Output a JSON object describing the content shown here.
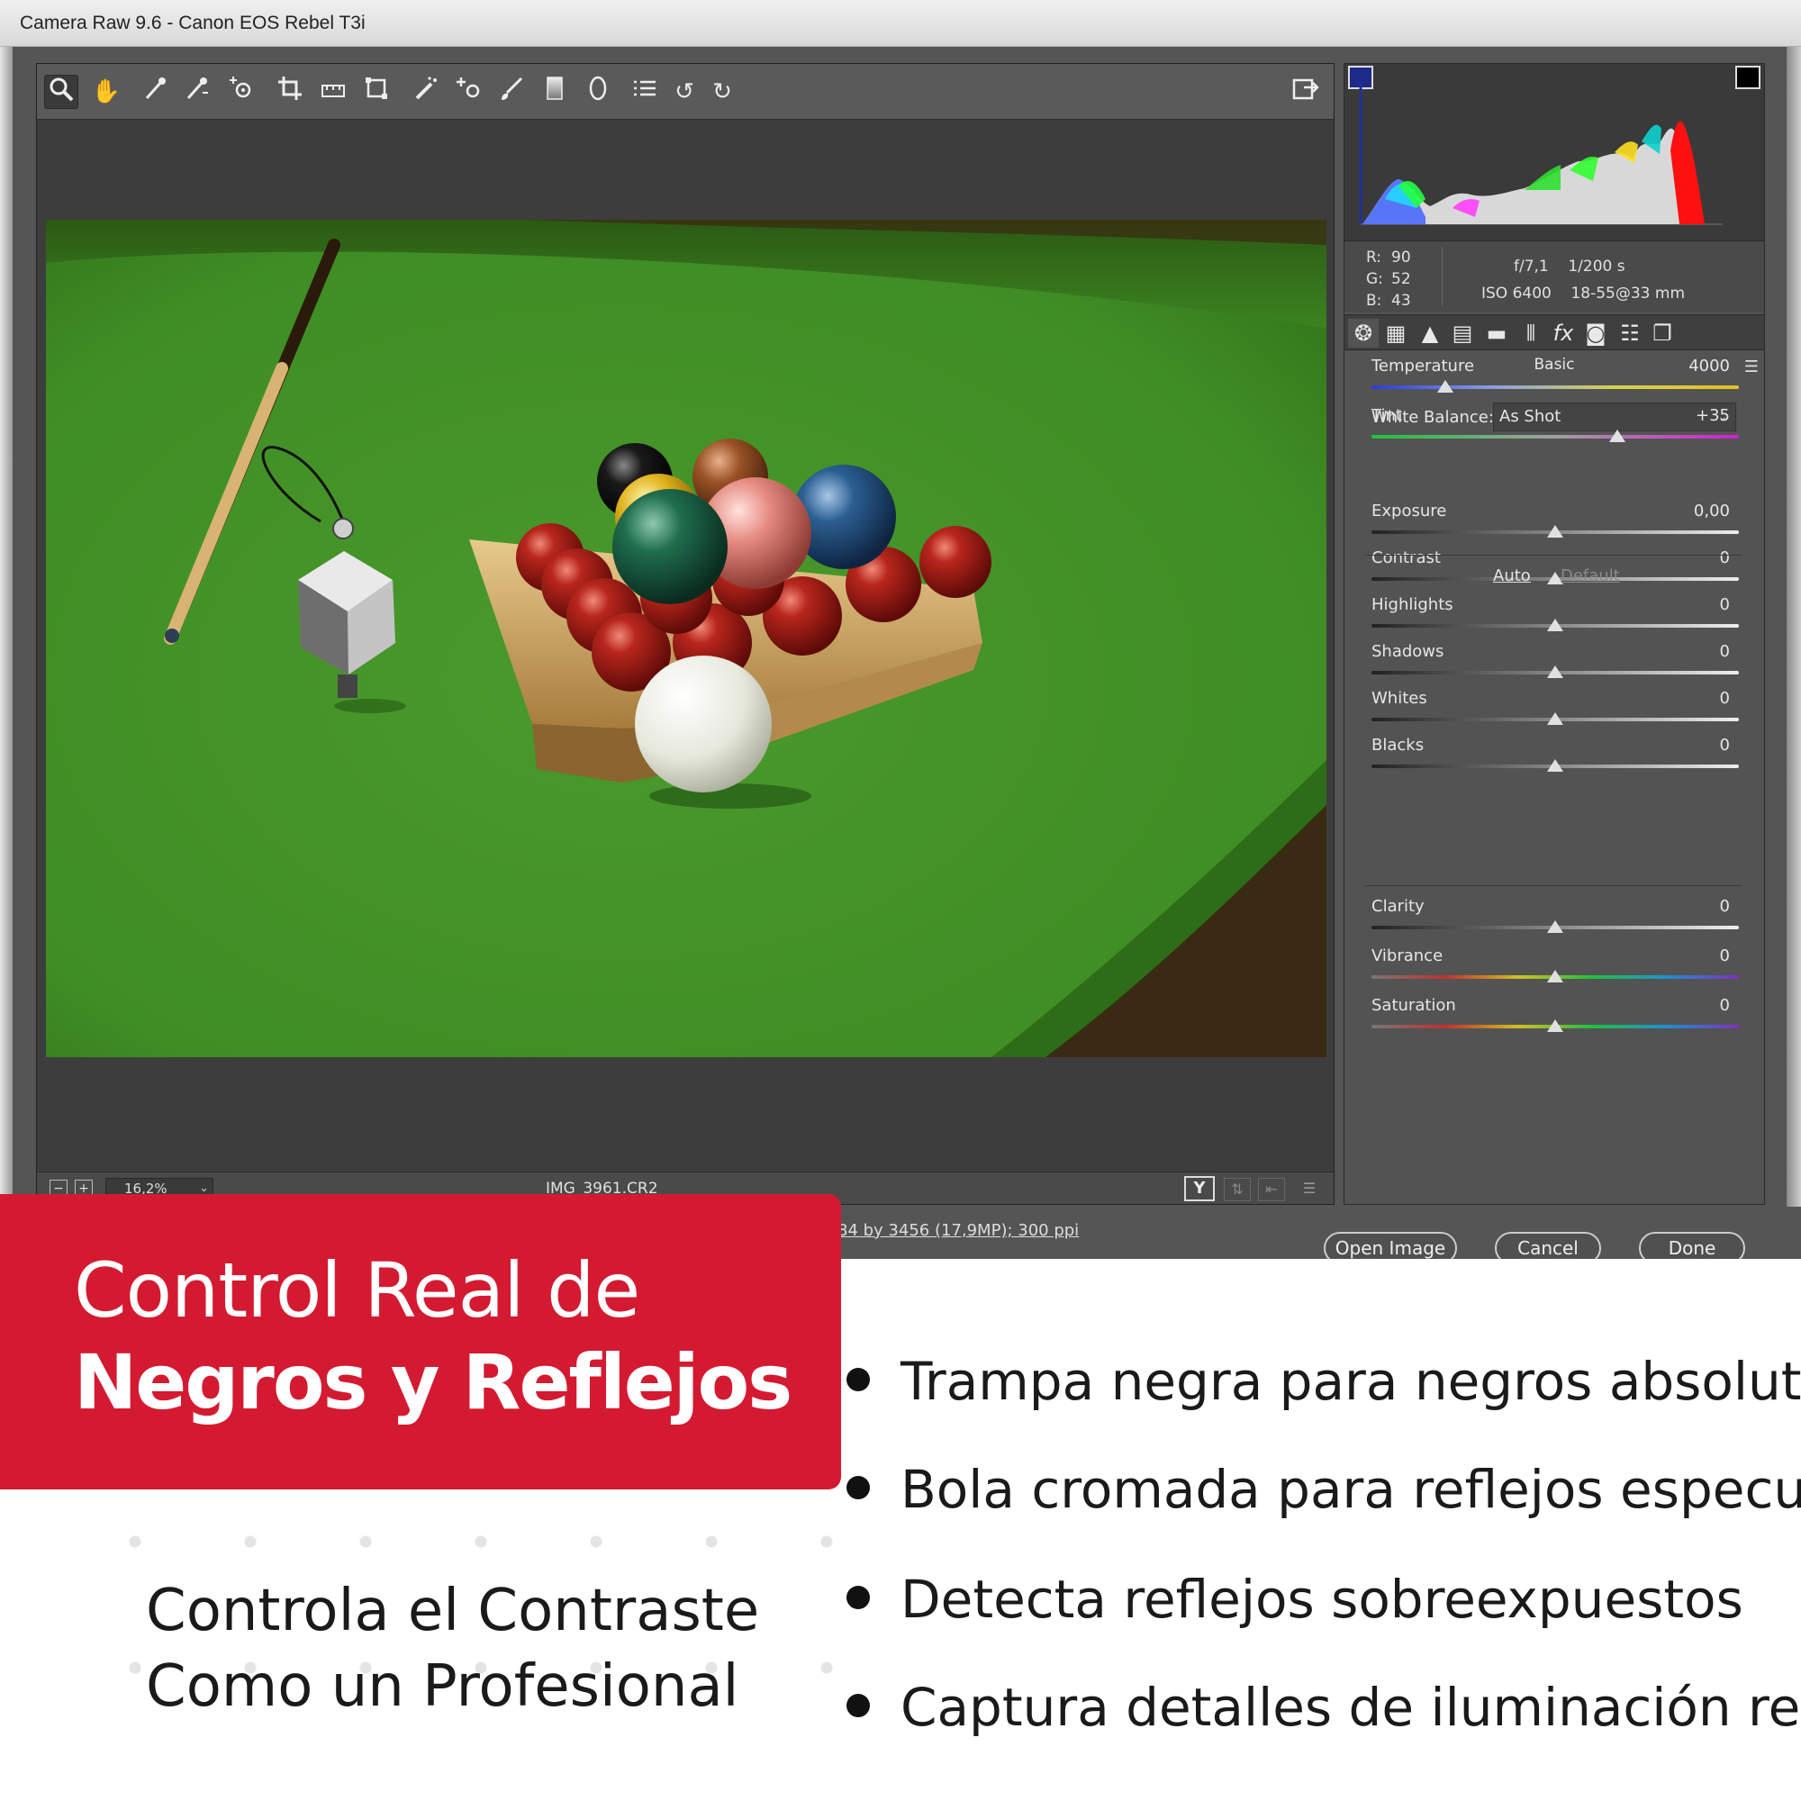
{
  "window": {
    "title": "Camera Raw 9.6  -  Canon EOS Rebel T3i"
  },
  "toolbar": {
    "tools": [
      {
        "icon": "zoom-icon",
        "glyph": "🔍"
      },
      {
        "icon": "hand-icon",
        "glyph": "✋"
      },
      {
        "icon": "white-balance-icon",
        "glyph": "⁄"
      },
      {
        "icon": "color-sampler-icon",
        "glyph": "⁄"
      },
      {
        "icon": "targeted-adjustment-icon",
        "glyph": "⊙"
      },
      {
        "icon": "crop-icon",
        "glyph": "⌗"
      },
      {
        "icon": "straighten-icon",
        "glyph": "▭"
      },
      {
        "icon": "transform-icon",
        "glyph": "⌑"
      },
      {
        "icon": "spot-removal-icon",
        "glyph": "✎"
      },
      {
        "icon": "red-eye-icon",
        "glyph": "+o"
      },
      {
        "icon": "adjustment-brush-icon",
        "glyph": "∕"
      },
      {
        "icon": "graduated-filter-icon",
        "glyph": "▮"
      },
      {
        "icon": "radial-filter-icon",
        "glyph": "○"
      },
      {
        "icon": "preferences-icon",
        "glyph": "☰"
      },
      {
        "icon": "rotate-left-icon",
        "glyph": "↺"
      },
      {
        "icon": "rotate-right-icon",
        "glyph": "↻"
      }
    ],
    "fullscreen_icon": "fullscreen-icon"
  },
  "preview": {
    "zoom": "16,2%",
    "filename": "IMG_3961.CR2",
    "y_button": "Y"
  },
  "readout": {
    "r": "90",
    "g": "52",
    "b": "43",
    "r_label": "R:",
    "g_label": "G:",
    "b_label": "B:",
    "aperture_shutter": "f/7,1    1/200 s",
    "iso_lens": "ISO 6400    18-55@33 mm"
  },
  "panel": {
    "section_title": "Basic",
    "white_balance_label": "White Balance:",
    "white_balance_value": "As Shot",
    "auto_label": "Auto",
    "default_label": "Default",
    "sliders": [
      {
        "label": "Temperature",
        "value": "4000",
        "position": 0.2
      },
      {
        "label": "Tint",
        "value": "+35",
        "position": 0.67
      },
      {
        "label": "Exposure",
        "value": "0,00",
        "position": 0.5
      },
      {
        "label": "Contrast",
        "value": "0",
        "position": 0.5
      },
      {
        "label": "Highlights",
        "value": "0",
        "position": 0.5
      },
      {
        "label": "Shadows",
        "value": "0",
        "position": 0.5
      },
      {
        "label": "Whites",
        "value": "0",
        "position": 0.5
      },
      {
        "label": "Blacks",
        "value": "0",
        "position": 0.5
      },
      {
        "label": "Clarity",
        "value": "0",
        "position": 0.5
      },
      {
        "label": "Vibrance",
        "value": "0",
        "position": 0.5
      },
      {
        "label": "Saturation",
        "value": "0",
        "position": 0.5
      }
    ]
  },
  "footer": {
    "dimensions": "84 by 3456 (17,9MP); 300 ppi",
    "open_image": "Open Image",
    "cancel": "Cancel",
    "done": "Done"
  },
  "promo": {
    "headline_1": "Control Real de",
    "headline_2": "Negros y Reflejos",
    "tagline_1": "Controla el Contraste",
    "tagline_2": "Como un Profesional",
    "bullets": [
      "Trampa negra para negros absolutos",
      "Bola cromada para reflejos especulares",
      "Detecta reflejos sobreexpuestos",
      "Captura detalles de iluminación realista"
    ],
    "accent_color": "#d41a31"
  }
}
